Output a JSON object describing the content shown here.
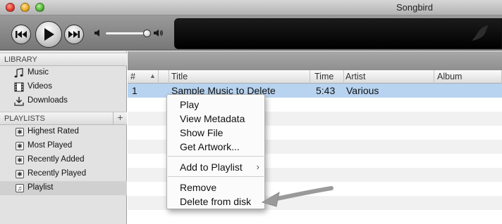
{
  "window": {
    "title": "Songbird"
  },
  "player": {
    "previous_icon": "previous-track-icon",
    "play_icon": "play-icon",
    "next_icon": "next-track-icon",
    "volume_level": 0.95
  },
  "sidebar": {
    "library_header": "LIBRARY",
    "library_items": [
      {
        "label": "Music",
        "icon": "music-note-icon"
      },
      {
        "label": "Videos",
        "icon": "film-icon"
      },
      {
        "label": "Downloads",
        "icon": "download-icon"
      }
    ],
    "playlists_header": "PLAYLISTS",
    "playlists_add": "+",
    "playlist_items": [
      {
        "label": "Highest Rated",
        "icon": "smart-playlist-icon"
      },
      {
        "label": "Most Played",
        "icon": "smart-playlist-icon"
      },
      {
        "label": "Recently Added",
        "icon": "smart-playlist-icon"
      },
      {
        "label": "Recently Played",
        "icon": "smart-playlist-icon"
      },
      {
        "label": "Playlist",
        "icon": "playlist-icon",
        "selected": true
      }
    ]
  },
  "tracklist": {
    "columns": [
      "#",
      "Title",
      "Time",
      "Artist",
      "Album"
    ],
    "sort_indicator": "▲",
    "rows": [
      {
        "num": "1",
        "title": "Sample Music to Delete",
        "time": "5:43",
        "artist": "Various",
        "album": "",
        "selected": true
      }
    ]
  },
  "context_menu": {
    "items": [
      {
        "label": "Play"
      },
      {
        "label": "View Metadata"
      },
      {
        "label": "Show File"
      },
      {
        "label": "Get Artwork..."
      },
      {
        "label": "Add to Playlist",
        "submenu": true,
        "submenu_glyph": "›"
      },
      {
        "label": "Remove"
      },
      {
        "label": "Delete from disk"
      }
    ]
  },
  "colors": {
    "selection": "#b7d3f0",
    "display_bg": "#000000"
  }
}
